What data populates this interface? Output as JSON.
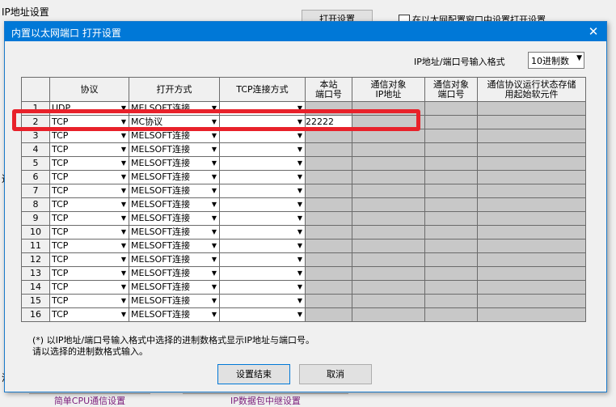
{
  "background": {
    "title": "IP地址设置",
    "open_settings_button": "打开设置",
    "checkbox_label": "在以太网配置窗口中设置打开设置",
    "bottom_button_1": "简单CPU通信设置",
    "bottom_button_2": "IP数据包中继设置",
    "left_mark": "通",
    "left_mark2": "满"
  },
  "dialog": {
    "title": "内置以太网端口 打开设置",
    "close_label": "✕",
    "format_label": "IP地址/端口号输入格式",
    "format_value": "10进制数",
    "columns": [
      "协议",
      "打开方式",
      "TCP连接方式",
      "本站\n端口号",
      "通信对象\nIP地址",
      "通信对象\n端口号",
      "通信协议运行状态存储\n用起始软元件"
    ],
    "rows": [
      {
        "n": "1",
        "protocol": "UDP",
        "open": "MELSOFT连接",
        "tcp": "",
        "port": ""
      },
      {
        "n": "2",
        "protocol": "TCP",
        "open": "MC协议",
        "tcp": "",
        "port": "22222"
      },
      {
        "n": "3",
        "protocol": "TCP",
        "open": "MELSOFT连接",
        "tcp": "",
        "port": ""
      },
      {
        "n": "4",
        "protocol": "TCP",
        "open": "MELSOFT连接",
        "tcp": "",
        "port": ""
      },
      {
        "n": "5",
        "protocol": "TCP",
        "open": "MELSOFT连接",
        "tcp": "",
        "port": ""
      },
      {
        "n": "6",
        "protocol": "TCP",
        "open": "MELSOFT连接",
        "tcp": "",
        "port": ""
      },
      {
        "n": "7",
        "protocol": "TCP",
        "open": "MELSOFT连接",
        "tcp": "",
        "port": ""
      },
      {
        "n": "8",
        "protocol": "TCP",
        "open": "MELSOFT连接",
        "tcp": "",
        "port": ""
      },
      {
        "n": "9",
        "protocol": "TCP",
        "open": "MELSOFT连接",
        "tcp": "",
        "port": ""
      },
      {
        "n": "10",
        "protocol": "TCP",
        "open": "MELSOFT连接",
        "tcp": "",
        "port": ""
      },
      {
        "n": "11",
        "protocol": "TCP",
        "open": "MELSOFT连接",
        "tcp": "",
        "port": ""
      },
      {
        "n": "12",
        "protocol": "TCP",
        "open": "MELSOFT连接",
        "tcp": "",
        "port": ""
      },
      {
        "n": "13",
        "protocol": "TCP",
        "open": "MELSOFT连接",
        "tcp": "",
        "port": ""
      },
      {
        "n": "14",
        "protocol": "TCP",
        "open": "MELSOFT连接",
        "tcp": "",
        "port": ""
      },
      {
        "n": "15",
        "protocol": "TCP",
        "open": "MELSOFT连接",
        "tcp": "",
        "port": ""
      },
      {
        "n": "16",
        "protocol": "TCP",
        "open": "MELSOFT连接",
        "tcp": "",
        "port": ""
      }
    ],
    "note_line1": "(*) 以IP地址/端口号输入格式中选择的进制数格式显示IP地址与端口号。",
    "note_line2": "请以选择的进制数格式输入。",
    "ok_button": "设置结束",
    "cancel_button": "取消",
    "highlight_color": "#e8212a"
  }
}
